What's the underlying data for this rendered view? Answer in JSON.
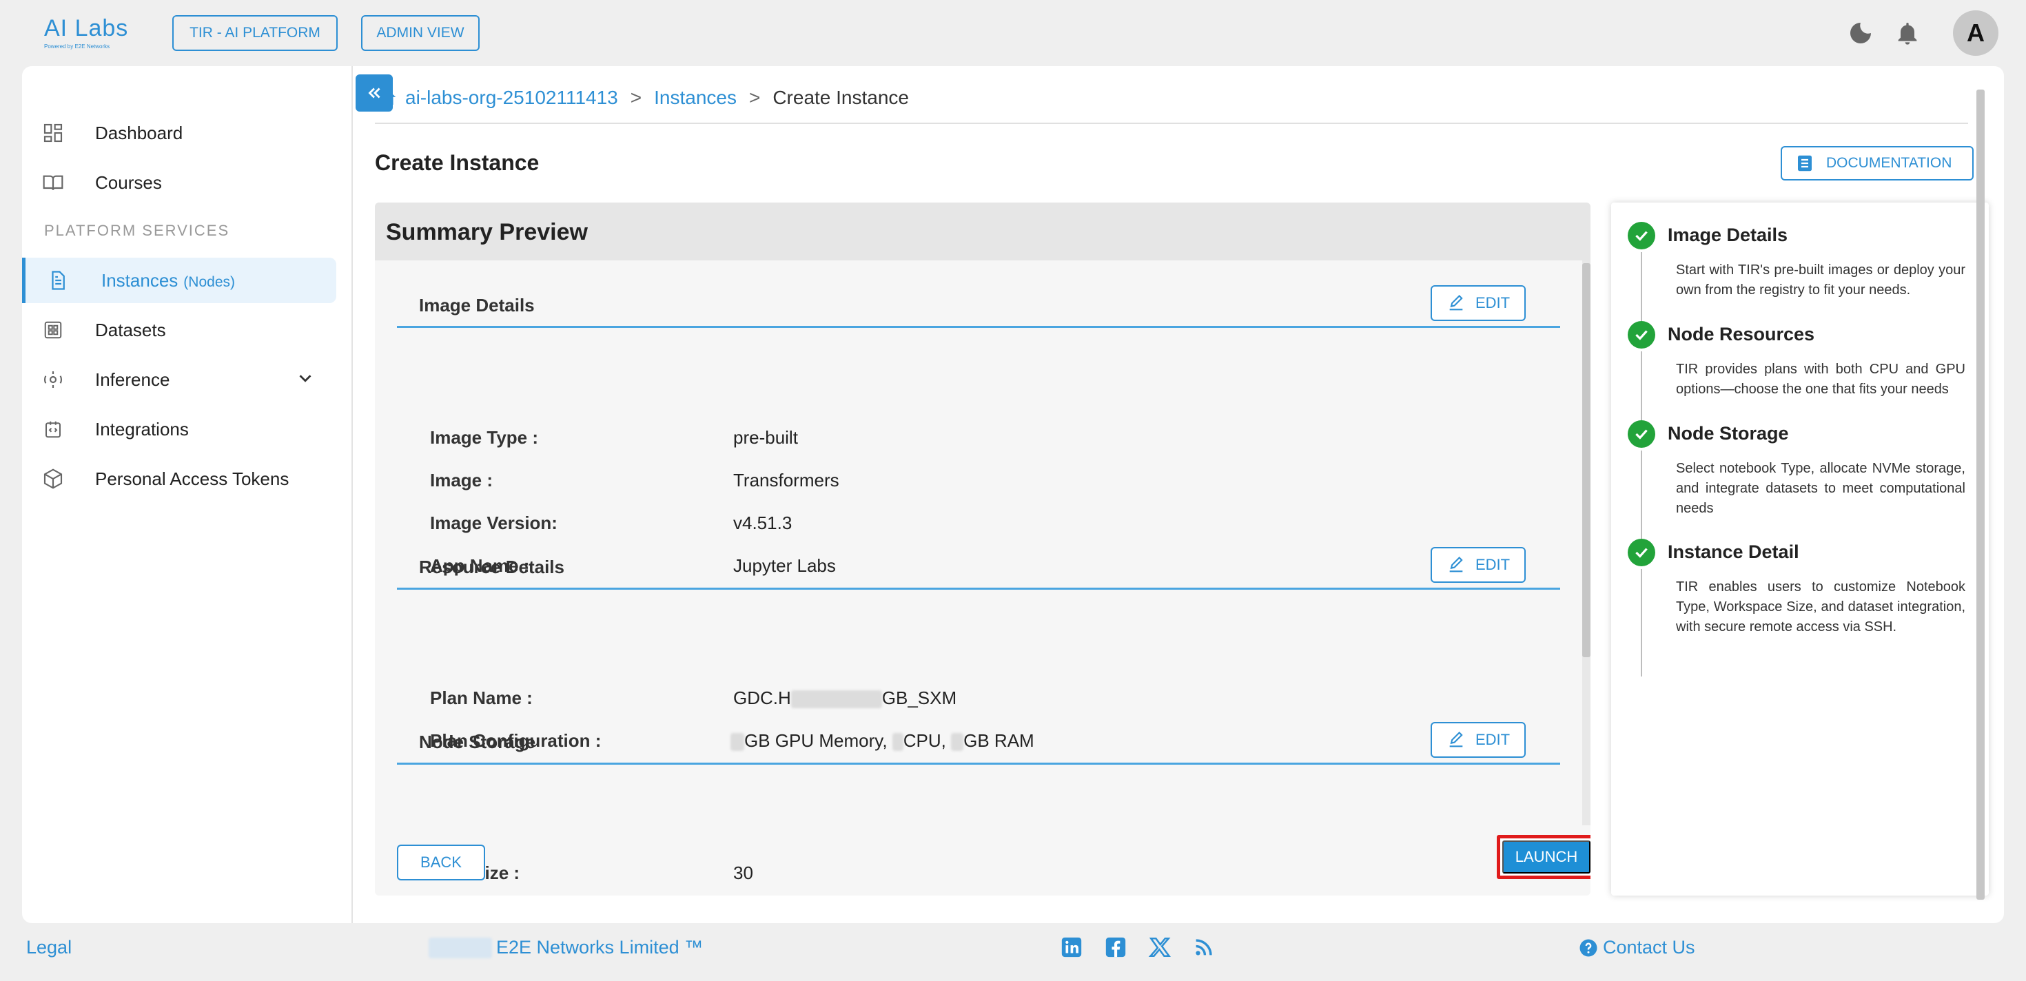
{
  "header": {
    "logo_text": "AI Labs",
    "logo_sub": "Powered by E2E Networks",
    "tir_button": "TIR - AI PLATFORM",
    "admin_button": "ADMIN VIEW",
    "avatar_letter": "A"
  },
  "sidebar": {
    "items": [
      {
        "label": "Dashboard"
      },
      {
        "label": "Courses"
      },
      {
        "label": "Instances",
        "sub": "(Nodes)"
      },
      {
        "label": "Datasets"
      },
      {
        "label": "Inference"
      },
      {
        "label": "Integrations"
      },
      {
        "label": "Personal Access Tokens"
      }
    ],
    "section_label": "PLATFORM SERVICES"
  },
  "breadcrumb": {
    "org": "ai-labs-org-25102111413",
    "sep": ">",
    "instances": "Instances",
    "current": "Create Instance"
  },
  "page": {
    "title": "Create Instance",
    "doc_button": "DOCUMENTATION"
  },
  "summary": {
    "title": "Summary Preview",
    "edit_label": "EDIT",
    "sections": {
      "image": {
        "title": "Image Details",
        "rows": [
          {
            "k": "Image Type :",
            "v": "pre-built"
          },
          {
            "k": "Image :",
            "v": "Transformers"
          },
          {
            "k": "Image Version:",
            "v": "v4.51.3"
          },
          {
            "k": "App Name :",
            "v": "Jupyter Labs"
          }
        ]
      },
      "resource": {
        "title": "Resource Details",
        "plan_name_key": "Plan Name :",
        "plan_name_prefix": "GDC.H",
        "plan_name_suffix": "GB_SXM",
        "plan_config_key": "Plan Configuration :",
        "plan_config_gpu": "GB GPU Memory,",
        "plan_config_cpu": "CPU,",
        "plan_config_ram": "GB RAM"
      },
      "storage": {
        "title": "Node Storage",
        "rows": [
          {
            "k": "Disk Size :",
            "v": "30"
          }
        ]
      }
    },
    "back_button": "BACK",
    "launch_button": "LAUNCH"
  },
  "steps": [
    {
      "title": "Image Details",
      "desc": "Start with TIR's pre-built images or deploy your own from the registry to fit your needs."
    },
    {
      "title": "Node Resources",
      "desc": "TIR provides plans with both CPU and GPU options—choose the one that fits your needs"
    },
    {
      "title": "Node Storage",
      "desc": "Select notebook Type, allocate NVMe storage, and integrate datasets to meet computational needs"
    },
    {
      "title": "Instance Detail",
      "desc": "TIR enables users to customize Notebook Type, Workspace Size, and dataset integration, with secure remote access via SSH."
    }
  ],
  "footer": {
    "legal": "Legal",
    "company": "E2E Networks Limited ™",
    "contact": "Contact Us"
  },
  "colors": {
    "accent": "#2d8fd4",
    "success": "#22a33a",
    "highlight": "#e01b1b"
  }
}
